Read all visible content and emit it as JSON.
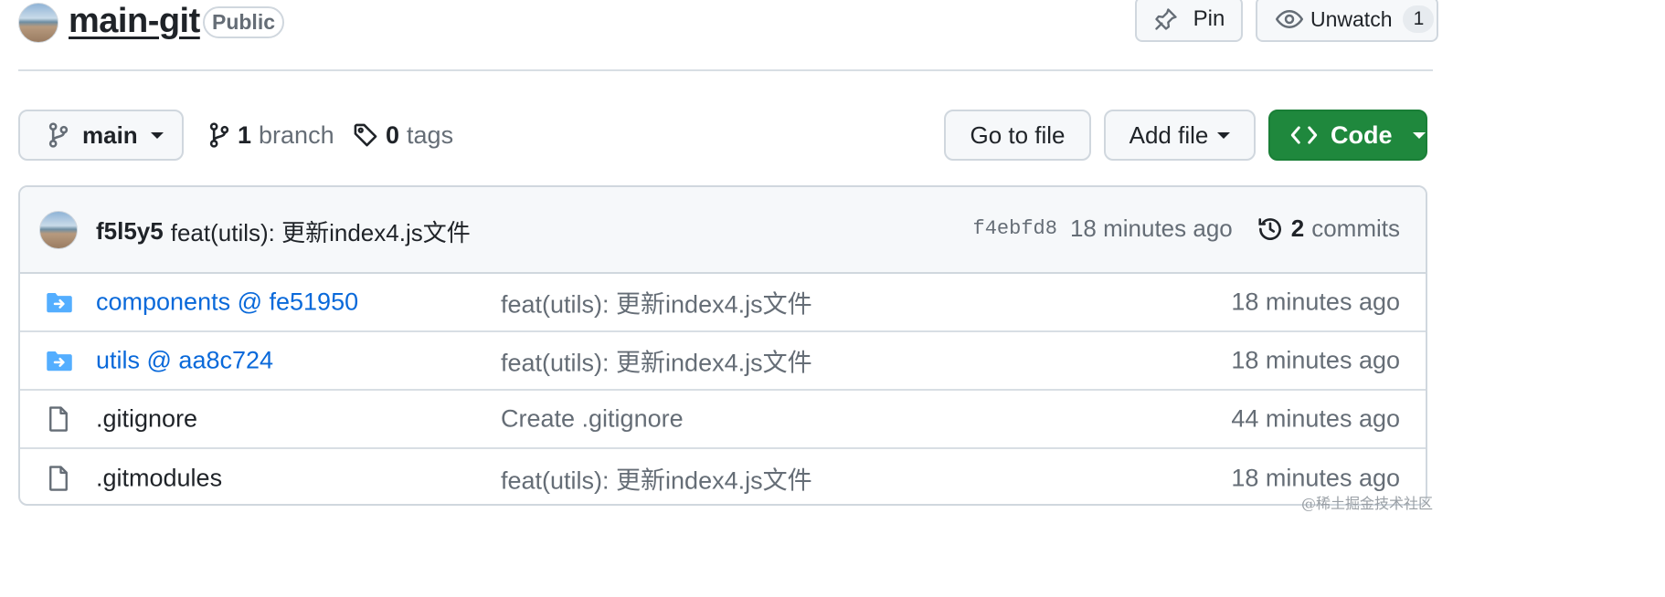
{
  "repo": {
    "name": "main-git",
    "visibility": "Public"
  },
  "header_actions": {
    "pin_label": "Pin",
    "unwatch_label": "Unwatch",
    "watch_count": "1"
  },
  "branch_bar": {
    "current_branch": "main",
    "branch_count": "1",
    "branch_label": "branch",
    "tag_count": "0",
    "tag_label": "tags",
    "go_to_file": "Go to file",
    "add_file": "Add file",
    "code": "Code"
  },
  "latest_commit": {
    "author": "f5l5y5",
    "message": "feat(utils): 更新index4.js文件",
    "sha": "f4ebfd8",
    "time": "18 minutes ago",
    "commit_count": "2",
    "commit_label": "commits"
  },
  "files": [
    {
      "name": "components @ fe51950",
      "type": "submodule",
      "icon": "submodule-folder-icon",
      "message": "feat(utils): 更新index4.js文件",
      "time": "18 minutes ago"
    },
    {
      "name": "utils @ aa8c724",
      "type": "submodule",
      "icon": "submodule-folder-icon",
      "message": "feat(utils): 更新index4.js文件",
      "time": "18 minutes ago"
    },
    {
      "name": ".gitignore",
      "type": "file",
      "icon": "file-icon",
      "message": "Create .gitignore",
      "time": "44 minutes ago"
    },
    {
      "name": ".gitmodules",
      "type": "file",
      "icon": "file-icon",
      "message": "feat(utils): 更新index4.js文件",
      "time": "18 minutes ago"
    }
  ],
  "watermark": "@稀土掘金技术社区",
  "colors": {
    "accent_green": "#1f883d",
    "link_blue": "#0969da",
    "muted_text": "#656d76",
    "border": "#d0d7de",
    "submodule_folder": "#54aeff"
  }
}
